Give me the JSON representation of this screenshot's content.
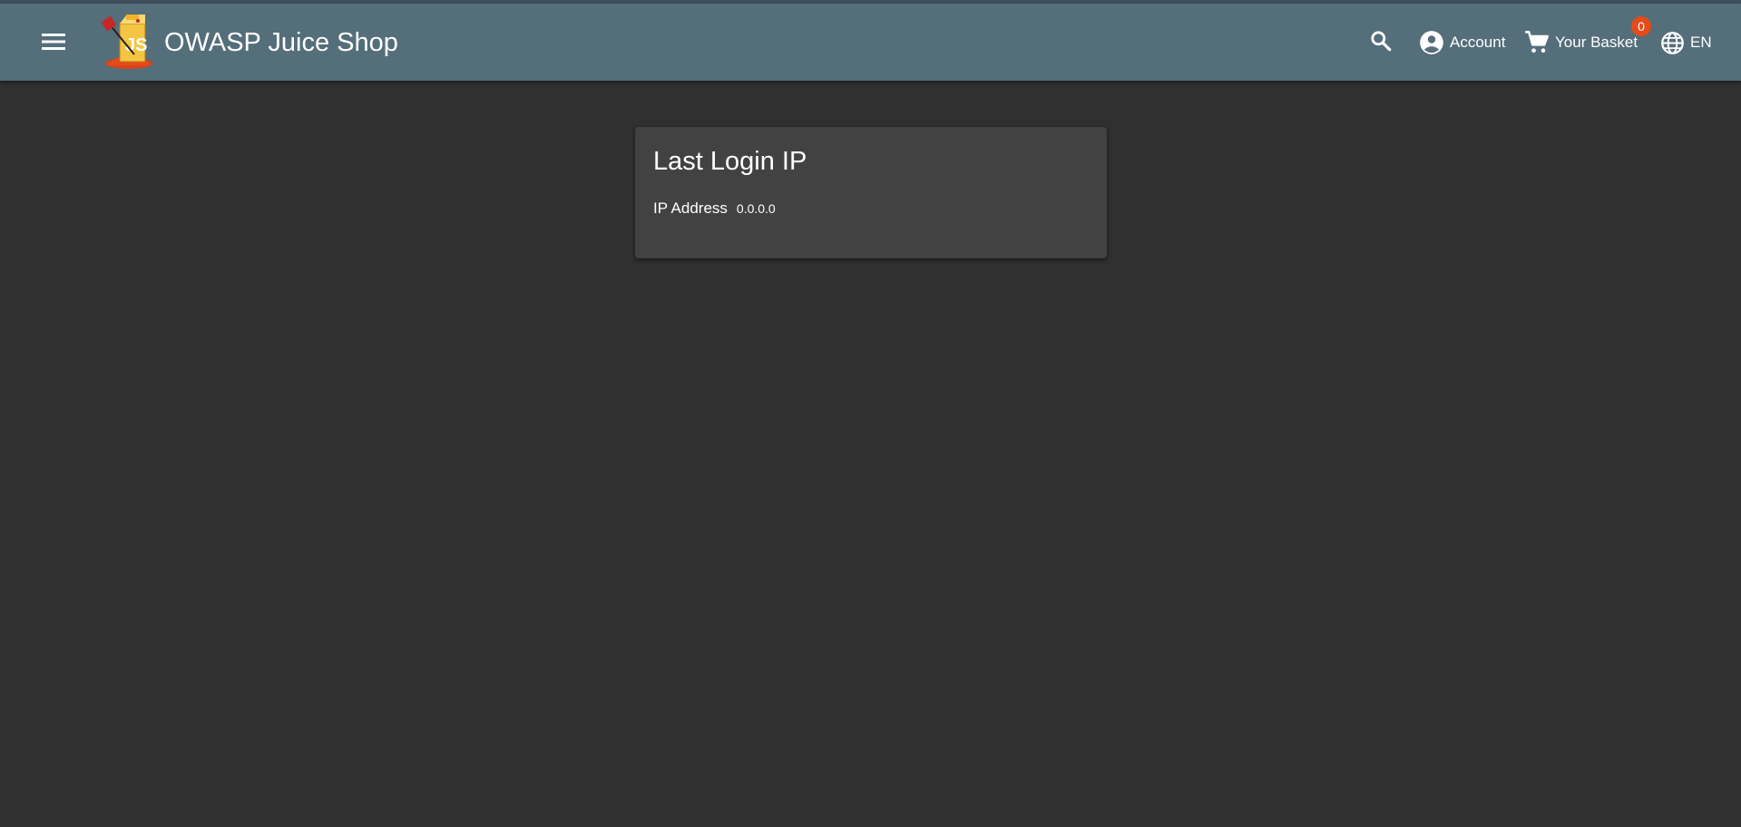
{
  "header": {
    "app_title": "OWASP Juice Shop",
    "icons": {
      "menu": "menu-icon",
      "logo": "juice-shop-logo",
      "search": "search-icon",
      "account": "account-circle-icon",
      "basket": "shopping-cart-icon",
      "language": "globe-icon"
    },
    "account_label": "Account",
    "basket_label": "Your Basket",
    "basket_count": "0",
    "language_label": "EN"
  },
  "card": {
    "title": "Last Login IP",
    "ip_label": "IP Address",
    "ip_value": "0.0.0.0"
  },
  "colors": {
    "toolbar": "#546e7a",
    "background": "#303030",
    "card": "#424242",
    "badge": "#e64a19"
  }
}
